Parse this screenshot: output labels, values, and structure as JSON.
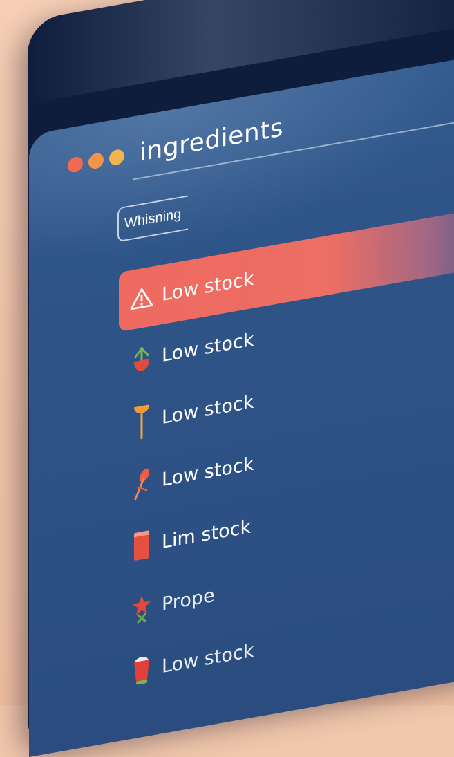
{
  "window": {
    "title": "ingredients",
    "controls": [
      "close",
      "minimize",
      "maximize"
    ]
  },
  "search": {
    "value": "Whisning"
  },
  "items": [
    {
      "label": "Low stock",
      "icon": "warning-icon",
      "highlighted": true
    },
    {
      "label": "Low stock",
      "icon": "herb-bowl-icon",
      "highlighted": false
    },
    {
      "label": "Low stock",
      "icon": "whisk-icon",
      "highlighted": false
    },
    {
      "label": "Low stock",
      "icon": "spice-icon",
      "highlighted": false
    },
    {
      "label": "Lim stock",
      "icon": "jar-icon",
      "highlighted": false
    },
    {
      "label": "Prope",
      "icon": "star-anise-icon",
      "highlighted": false
    },
    {
      "label": "Low stock",
      "icon": "cup-icon",
      "highlighted": false
    }
  ],
  "colors": {
    "accent": "#ef6a60",
    "screen": "#2e5487",
    "bezel": "#0e1d3c",
    "background": "#f2c8ac"
  }
}
